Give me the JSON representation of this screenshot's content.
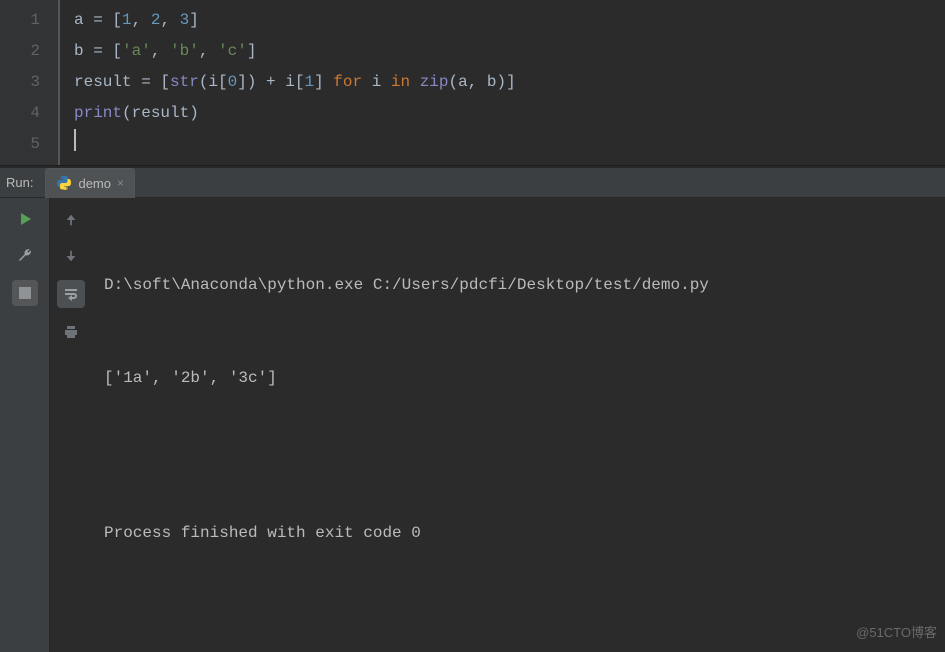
{
  "editor": {
    "lines": [
      {
        "n": "1",
        "tokens": [
          {
            "t": "a = [",
            "c": "tok-default"
          },
          {
            "t": "1",
            "c": "tok-num"
          },
          {
            "t": ", ",
            "c": "tok-default"
          },
          {
            "t": "2",
            "c": "tok-num"
          },
          {
            "t": ", ",
            "c": "tok-default"
          },
          {
            "t": "3",
            "c": "tok-num"
          },
          {
            "t": "]",
            "c": "tok-default"
          }
        ]
      },
      {
        "n": "2",
        "tokens": [
          {
            "t": "b = [",
            "c": "tok-default"
          },
          {
            "t": "'a'",
            "c": "tok-str"
          },
          {
            "t": ", ",
            "c": "tok-default"
          },
          {
            "t": "'b'",
            "c": "tok-str"
          },
          {
            "t": ", ",
            "c": "tok-default"
          },
          {
            "t": "'c'",
            "c": "tok-str"
          },
          {
            "t": "]",
            "c": "tok-default"
          }
        ]
      },
      {
        "n": "3",
        "tokens": [
          {
            "t": "result = [",
            "c": "tok-default"
          },
          {
            "t": "str",
            "c": "tok-builtin"
          },
          {
            "t": "(i[",
            "c": "tok-default"
          },
          {
            "t": "0",
            "c": "tok-num"
          },
          {
            "t": "]) + i[",
            "c": "tok-default"
          },
          {
            "t": "1",
            "c": "tok-num"
          },
          {
            "t": "] ",
            "c": "tok-default"
          },
          {
            "t": "for ",
            "c": "tok-kw"
          },
          {
            "t": "i ",
            "c": "tok-default"
          },
          {
            "t": "in ",
            "c": "tok-kw"
          },
          {
            "t": "zip",
            "c": "tok-builtin"
          },
          {
            "t": "(a, b)]",
            "c": "tok-default"
          }
        ]
      },
      {
        "n": "4",
        "tokens": [
          {
            "t": "print",
            "c": "tok-builtin"
          },
          {
            "t": "(result)",
            "c": "tok-default"
          }
        ]
      },
      {
        "n": "5",
        "tokens": []
      }
    ]
  },
  "run": {
    "label": "Run:",
    "tab_name": "demo",
    "close_glyph": "×",
    "output": {
      "cmd": "D:\\soft\\Anaconda\\python.exe C:/Users/pdcfi/Desktop/test/demo.py",
      "result": "['1a', '2b', '3c']",
      "blank": "",
      "exit": "Process finished with exit code 0"
    }
  },
  "watermark": "@51CTO博客"
}
